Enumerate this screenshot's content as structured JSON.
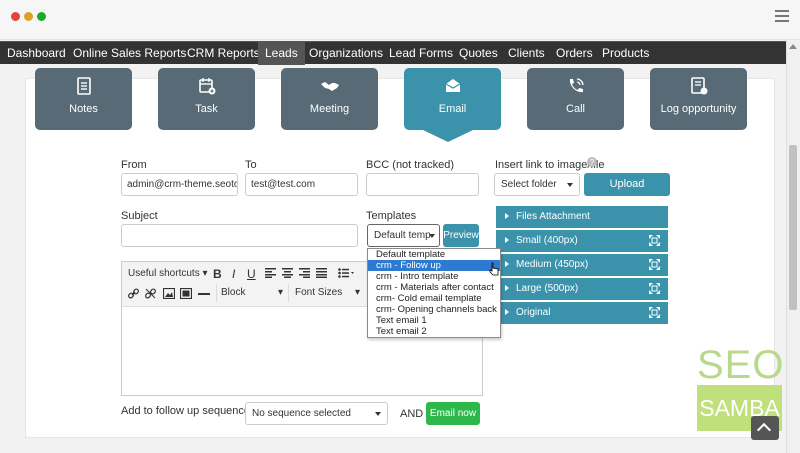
{
  "nav": [
    {
      "label": "Dashboard"
    },
    {
      "label": "Online Sales Reports"
    },
    {
      "label": "CRM Reports"
    },
    {
      "label": "Leads"
    },
    {
      "label": "Organizations"
    },
    {
      "label": "Lead Forms"
    },
    {
      "label": "Quotes"
    },
    {
      "label": "Clients"
    },
    {
      "label": "Orders"
    },
    {
      "label": "Products"
    }
  ],
  "active_nav": "Leads",
  "tiles": [
    {
      "label": "Notes",
      "icon": "notes-icon"
    },
    {
      "label": "Task",
      "icon": "task-icon"
    },
    {
      "label": "Meeting",
      "icon": "handshake-icon"
    },
    {
      "label": "Email",
      "icon": "envelope-icon"
    },
    {
      "label": "Call",
      "icon": "phone-icon"
    },
    {
      "label": "Log opportunity",
      "icon": "log-icon"
    }
  ],
  "active_tile": "Email",
  "form": {
    "from_label": "From",
    "from_value": "admin@crm-theme.seotoa",
    "to_label": "To",
    "to_value": "test@test.com",
    "bcc_label": "BCC (not tracked)",
    "bcc_value": "",
    "insert_link_label": "Insert link to image/file",
    "select_folder": "Select folder",
    "upload_label": "Upload",
    "subject_label": "Subject",
    "subject_value": "",
    "templates_label": "Templates",
    "templates_value": "Default temp",
    "preview_label": "Preview",
    "follow_up_label": "Add to follow up sequences",
    "sequence_value": "No sequence selected",
    "and_label": "AND",
    "email_now_label": "Email now"
  },
  "editor": {
    "shortcuts": "Useful shortcuts",
    "bold": "B",
    "italic": "I",
    "underline": "U",
    "block": "Block",
    "font_sizes": "Font Sizes"
  },
  "templates_dropdown": [
    {
      "label": "Default template"
    },
    {
      "label": "crm - Follow up"
    },
    {
      "label": "crm - Intro template"
    },
    {
      "label": "crm - Materials after contact"
    },
    {
      "label": "crm- Cold email template"
    },
    {
      "label": "crm- Opening channels back up"
    },
    {
      "label": "Text email 1"
    },
    {
      "label": "Text email 2"
    }
  ],
  "selected_template": "crm - Follow up",
  "accordion": [
    {
      "label": "Files Attachment",
      "expand": false
    },
    {
      "label": "Small (400px)",
      "expand": true
    },
    {
      "label": "Medium (450px)",
      "expand": true
    },
    {
      "label": "Large (500px)",
      "expand": true
    },
    {
      "label": "Original",
      "expand": true
    }
  ],
  "watermark": {
    "top": "SEO",
    "bottom": "SAMBA"
  },
  "colors": {
    "accent": "#3a93ab",
    "tile": "#576a75",
    "nav": "#333333",
    "success": "#2eb84b",
    "highlight": "#2e7ad1"
  }
}
